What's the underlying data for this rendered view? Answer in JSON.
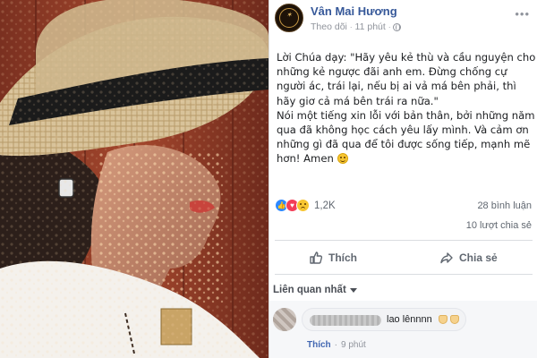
{
  "post": {
    "author": "Vân Mai Hương",
    "follow_label": "Theo dõi",
    "time": "11 phút",
    "paragraphs": [
      "Lời Chúa dạy: \"Hãy yêu kẻ thù và cầu nguyện cho những kẻ ngược đãi anh em. Đừng chống cự người ác, trái lại, nếu bị ai vả má bên phải, thì hãy giơ cả má bên trái ra nữa.\"",
      "Nói một tiếng xin lỗi với bản thân, bởi những năm qua đã không học cách yêu lấy mình. Và cảm ơn những gì đã qua để tôi được sống tiếp, mạnh mẽ hơn! Amen"
    ],
    "reaction_count": "1,2K",
    "comment_count": "28 bình luận",
    "share_count": "10 lượt chia sẻ"
  },
  "actions": {
    "like_label": "Thích",
    "share_label": "Chia sẻ"
  },
  "comments": {
    "sort_label": "Liên quan nhất",
    "items": [
      {
        "text": "lao lênnnn",
        "like_action": "Thích",
        "time": "9 phút"
      }
    ]
  },
  "icons": {
    "avatar": "page-logo",
    "globe": "globe-icon",
    "more": "more-icon",
    "like": "like-icon",
    "share": "share-icon",
    "caret": "caret-down-icon",
    "comment_emoji": "muscle-icon"
  },
  "colors": {
    "author_link": "#365899",
    "secondary_text": "#606770",
    "muted_text": "#90949c",
    "like_reaction": "#2d88ff",
    "love_reaction": "#f33e58",
    "sad_reaction": "#f7c531",
    "photo_wall": "#8e3b28"
  }
}
